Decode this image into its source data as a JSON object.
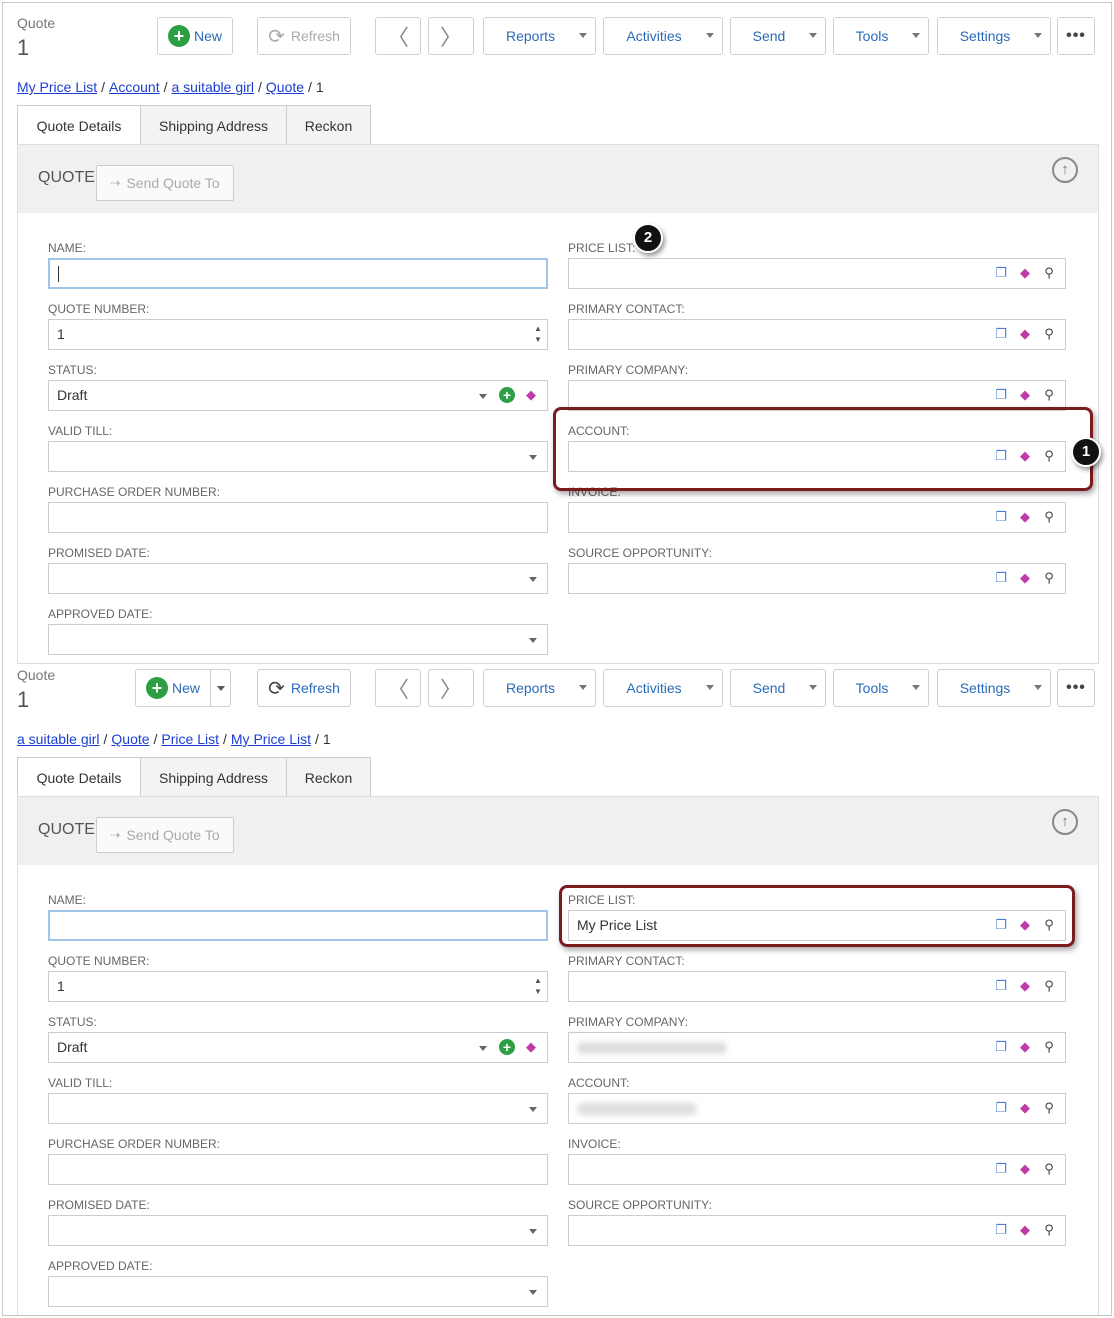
{
  "panels": [
    {
      "record_type": "Quote",
      "record_number": "1",
      "toolbar": {
        "new_label": "New",
        "refresh_label": "Refresh",
        "reports_label": "Reports",
        "activities_label": "Activities",
        "send_label": "Send",
        "tools_label": "Tools",
        "settings_label": "Settings"
      },
      "breadcrumb": [
        "My Price List",
        "Account",
        "a suitable girl",
        "Quote",
        "1"
      ],
      "tabs": [
        "Quote Details",
        "Shipping Address",
        "Reckon"
      ],
      "section_title": "QUOTE",
      "send_quote_label": "Send Quote To",
      "fields": {
        "name_label": "NAME:",
        "name_value": "",
        "quote_number_label": "QUOTE NUMBER:",
        "quote_number_value": "1",
        "status_label": "STATUS:",
        "status_value": "Draft",
        "valid_till_label": "VALID TILL:",
        "po_number_label": "PURCHASE ORDER NUMBER:",
        "promised_date_label": "PROMISED DATE:",
        "approved_date_label": "APPROVED DATE:",
        "price_list_label": "PRICE LIST:",
        "price_list_value": "",
        "primary_contact_label": "PRIMARY CONTACT:",
        "primary_company_label": "PRIMARY COMPANY:",
        "account_label": "ACCOUNT:",
        "invoice_label": "INVOICE:",
        "source_opportunity_label": "SOURCE OPPORTUNITY:"
      },
      "markers": [
        "2",
        "1"
      ]
    },
    {
      "record_type": "Quote",
      "record_number": "1",
      "toolbar": {
        "new_label": "New",
        "refresh_label": "Refresh",
        "reports_label": "Reports",
        "activities_label": "Activities",
        "send_label": "Send",
        "tools_label": "Tools",
        "settings_label": "Settings"
      },
      "breadcrumb": [
        "a suitable girl",
        "Quote",
        "Price List",
        "My Price List",
        "1"
      ],
      "tabs": [
        "Quote Details",
        "Shipping Address",
        "Reckon"
      ],
      "section_title": "QUOTE",
      "send_quote_label": "Send Quote To",
      "fields": {
        "name_label": "NAME:",
        "name_value": "",
        "quote_number_label": "QUOTE NUMBER:",
        "quote_number_value": "1",
        "status_label": "STATUS:",
        "status_value": "Draft",
        "valid_till_label": "VALID TILL:",
        "po_number_label": "PURCHASE ORDER NUMBER:",
        "promised_date_label": "PROMISED DATE:",
        "approved_date_label": "APPROVED DATE:",
        "price_list_label": "PRICE LIST:",
        "price_list_value": "My Price List",
        "primary_contact_label": "PRIMARY CONTACT:",
        "primary_company_label": "PRIMARY COMPANY:",
        "account_label": "ACCOUNT:",
        "invoice_label": "INVOICE:",
        "source_opportunity_label": "SOURCE OPPORTUNITY:"
      }
    }
  ],
  "colors": {
    "link": "#1a3fd0",
    "toolbar_text": "#2a6bb8",
    "add_green": "#2e9e45",
    "highlight_border": "#7a1c1e",
    "eraser": "#c03aa8",
    "copy": "#4a7fd1"
  }
}
